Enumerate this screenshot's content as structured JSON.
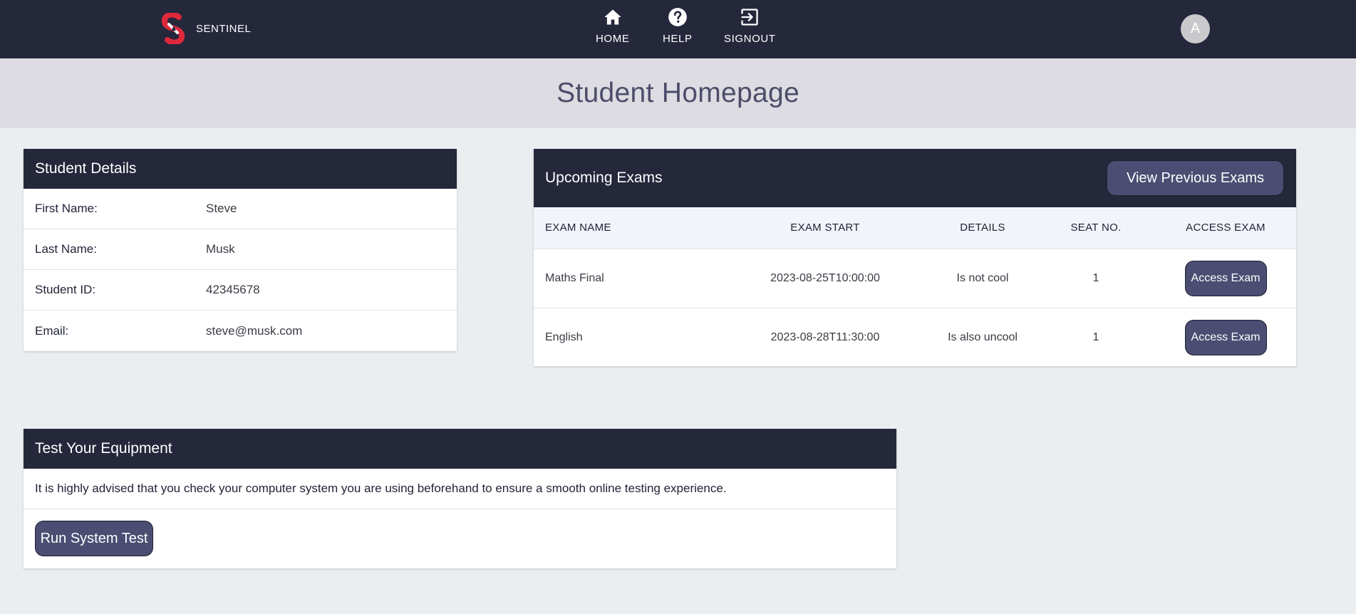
{
  "navbar": {
    "brand_name": "SENTINEL",
    "items": [
      {
        "label": "HOME",
        "icon": "home-icon"
      },
      {
        "label": "HELP",
        "icon": "help-circle-icon"
      },
      {
        "label": "SIGNOUT",
        "icon": "sign-out-icon"
      }
    ],
    "avatar_initial": "A"
  },
  "hero": {
    "title": "Student Homepage"
  },
  "student_details": {
    "title": "Student Details",
    "rows": [
      {
        "label": "First Name:",
        "value": "Steve"
      },
      {
        "label": "Last Name:",
        "value": "Musk"
      },
      {
        "label": "Student ID:",
        "value": "42345678"
      },
      {
        "label": "Email:",
        "value": "steve@musk.com"
      }
    ]
  },
  "upcoming_exams": {
    "title": "Upcoming Exams",
    "view_previous_label": "View Previous Exams",
    "columns": [
      "EXAM NAME",
      "EXAM START",
      "DETAILS",
      "SEAT NO.",
      "ACCESS EXAM"
    ],
    "rows": [
      {
        "name": "Maths Final",
        "start": "2023-08-25T10:00:00",
        "details": "Is not cool",
        "seat": "1",
        "action": "Access Exam"
      },
      {
        "name": "English",
        "start": "2023-08-28T11:30:00",
        "details": "Is also uncool",
        "seat": "1",
        "action": "Access Exam"
      }
    ]
  },
  "equipment": {
    "title": "Test Your Equipment",
    "description": "It is highly advised that you check your computer system you are using beforehand to ensure a smooth online testing experience.",
    "run_label": "Run System Test"
  },
  "colors": {
    "navbar_bg": "#25273b",
    "hero_bg": "#dcdce2",
    "page_bg": "#eaeef1",
    "button_bg": "#4b4e72",
    "brand_red": "#e0283c"
  }
}
